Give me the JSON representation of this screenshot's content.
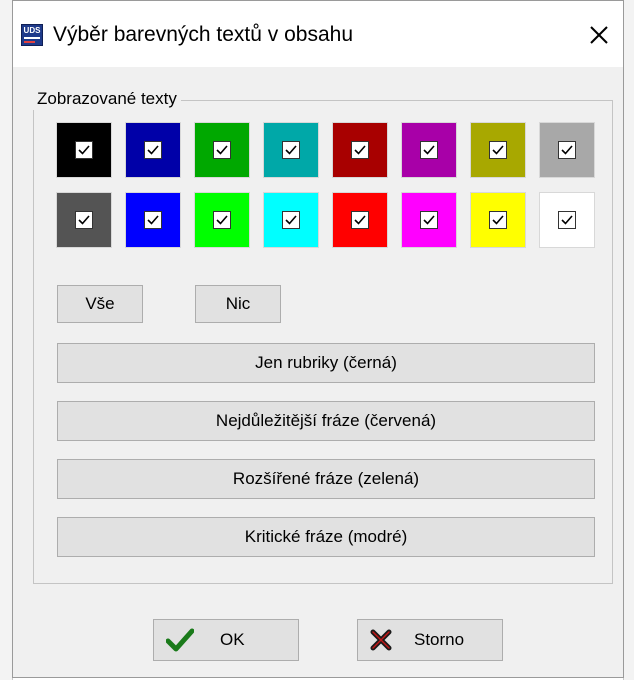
{
  "window": {
    "title": "Výběr barevných textů v obsahu",
    "icon": "app-logo-icon",
    "close_icon": "close-icon"
  },
  "group": {
    "label": "Zobrazované texty"
  },
  "swatches": {
    "row1": [
      {
        "color": "#000000",
        "checked": true
      },
      {
        "color": "#0000a8",
        "checked": true
      },
      {
        "color": "#00a800",
        "checked": true
      },
      {
        "color": "#00a8a8",
        "checked": true
      },
      {
        "color": "#a80000",
        "checked": true
      },
      {
        "color": "#a800a8",
        "checked": true
      },
      {
        "color": "#a8a800",
        "checked": true
      },
      {
        "color": "#a8a8a8",
        "checked": true
      }
    ],
    "row2": [
      {
        "color": "#545454",
        "checked": true
      },
      {
        "color": "#0000ff",
        "checked": true
      },
      {
        "color": "#00ff00",
        "checked": true
      },
      {
        "color": "#00ffff",
        "checked": true
      },
      {
        "color": "#ff0000",
        "checked": true
      },
      {
        "color": "#ff00ff",
        "checked": true
      },
      {
        "color": "#ffff00",
        "checked": true
      },
      {
        "color": "#ffffff",
        "checked": true
      }
    ]
  },
  "buttons": {
    "all": "Vše",
    "none": "Nic",
    "only_headings": "Jen rubriky (černá)",
    "most_important": "Nejdůležitější fráze (červená)",
    "extended": "Rozšířené fráze (zelená)",
    "critical": "Kritické fráze (modré)"
  },
  "footer": {
    "ok_label": "OK",
    "ok_icon": "checkmark-icon",
    "ok_icon_color": "#1a7a1a",
    "cancel_label": "Storno",
    "cancel_icon": "x-mark-icon",
    "cancel_icon_color": "#1a1a1a"
  }
}
